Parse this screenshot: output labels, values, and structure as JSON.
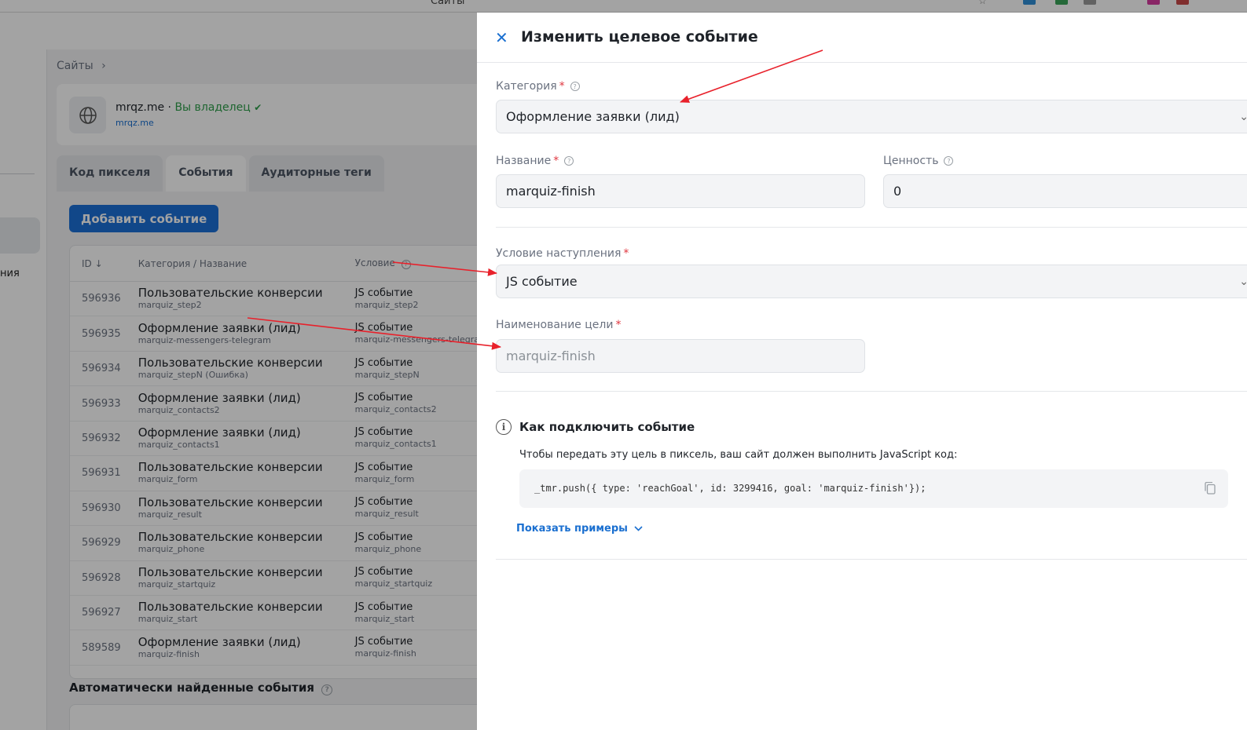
{
  "browser": {
    "title": "Сайты"
  },
  "sidebar": {
    "fragment_text": "ния"
  },
  "breadcrumb": {
    "item": "Сайты",
    "separator": "›"
  },
  "site": {
    "name": "mrqz.me",
    "dot": " · ",
    "owner_label": "Вы владелец",
    "check": "✔",
    "url": "mrqz.me"
  },
  "tabs": [
    {
      "label": "Код пикселя"
    },
    {
      "label": "События"
    },
    {
      "label": "Аудиторные теги"
    }
  ],
  "add_event_button": "Добавить событие",
  "events_table": {
    "headers": {
      "id": "ID ↓",
      "category": "Категория / Название",
      "condition": "Условие"
    },
    "rows": [
      {
        "id": "596936",
        "category": "Пользовательские конверсии",
        "name": "marquiz_step2",
        "condition": "JS событие",
        "goal": "marquiz_step2"
      },
      {
        "id": "596935",
        "category": "Оформление заявки (лид)",
        "name": "marquiz-messengers-telegram",
        "condition": "JS событие",
        "goal": "marquiz-messengers-telegram"
      },
      {
        "id": "596934",
        "category": "Пользовательские конверсии",
        "name": "marquiz_stepN (Ошибка)",
        "condition": "JS событие",
        "goal": "marquiz_stepN"
      },
      {
        "id": "596933",
        "category": "Оформление заявки (лид)",
        "name": "marquiz_contacts2",
        "condition": "JS событие",
        "goal": "marquiz_contacts2"
      },
      {
        "id": "596932",
        "category": "Оформление заявки (лид)",
        "name": "marquiz_contacts1",
        "condition": "JS событие",
        "goal": "marquiz_contacts1"
      },
      {
        "id": "596931",
        "category": "Пользовательские конверсии",
        "name": "marquiz_form",
        "condition": "JS событие",
        "goal": "marquiz_form"
      },
      {
        "id": "596930",
        "category": "Пользовательские конверсии",
        "name": "marquiz_result",
        "condition": "JS событие",
        "goal": "marquiz_result"
      },
      {
        "id": "596929",
        "category": "Пользовательские конверсии",
        "name": "marquiz_phone",
        "condition": "JS событие",
        "goal": "marquiz_phone"
      },
      {
        "id": "596928",
        "category": "Пользовательские конверсии",
        "name": "marquiz_startquiz",
        "condition": "JS событие",
        "goal": "marquiz_startquiz"
      },
      {
        "id": "596927",
        "category": "Пользовательские конверсии",
        "name": "marquiz_start",
        "condition": "JS событие",
        "goal": "marquiz_start"
      },
      {
        "id": "589589",
        "category": "Оформление заявки (лид)",
        "name": "marquiz-finish",
        "condition": "JS событие",
        "goal": "marquiz-finish"
      }
    ]
  },
  "auto_events_title": "Автоматически найденные события",
  "modal": {
    "title": "Изменить целевое событие",
    "category": {
      "label": "Категория",
      "value": "Оформление заявки (лид)"
    },
    "name": {
      "label": "Название",
      "value": "marquiz-finish"
    },
    "value": {
      "label": "Ценность",
      "value": "0"
    },
    "condition": {
      "label": "Условие наступления",
      "value": "JS событие"
    },
    "goal_name": {
      "label": "Наименование цели",
      "value": "marquiz-finish"
    },
    "howto": {
      "title": "Как подключить событие",
      "text": "Чтобы передать эту цель в пиксель, ваш сайт должен выполнить JavaScript код:",
      "code": "_tmr.push({ type: 'reachGoal', id: 3299416, goal: 'marquiz-finish'});",
      "show_examples": "Показать примеры"
    }
  },
  "colors": {
    "accent": "#1c6fd6",
    "required": "#e0363f",
    "annotation_arrow": "#e8212b",
    "owner": "#2e9e4a"
  },
  "icons": [
    "globe-icon",
    "close-icon",
    "help-icon",
    "chevron-down-icon",
    "info-icon",
    "copy-icon"
  ]
}
